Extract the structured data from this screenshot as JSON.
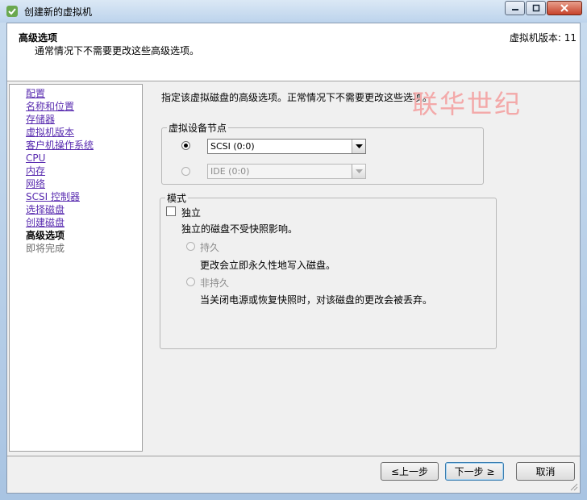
{
  "window": {
    "title": "创建新的虚拟机",
    "controls": [
      "minimize-icon",
      "maximize-icon",
      "close-icon"
    ]
  },
  "header": {
    "title": "高级选项",
    "subtitle": "通常情况下不需要更改这些高级选项。",
    "version": "虚拟机版本: 11"
  },
  "nav": {
    "items": [
      {
        "label": "配置",
        "state": "link"
      },
      {
        "label": "名称和位置",
        "state": "link"
      },
      {
        "label": "存储器",
        "state": "link"
      },
      {
        "label": "虚拟机版本",
        "state": "link"
      },
      {
        "label": "客户机操作系统",
        "state": "link"
      },
      {
        "label": "CPU",
        "state": "link"
      },
      {
        "label": "内存",
        "state": "link"
      },
      {
        "label": "网络",
        "state": "link"
      },
      {
        "label": "SCSI 控制器",
        "state": "link"
      },
      {
        "label": "选择磁盘",
        "state": "link"
      },
      {
        "label": "创建磁盘",
        "state": "link"
      },
      {
        "label": "高级选项",
        "state": "current"
      },
      {
        "label": "即将完成",
        "state": "future"
      }
    ]
  },
  "main": {
    "intro": "指定该虚拟磁盘的高级选项。正常情况下不需要更改这些选项。",
    "watermark": "联华世纪",
    "device_node": {
      "legend": "虚拟设备节点",
      "scsi_value": "SCSI (0:0)",
      "scsi_selected": true,
      "ide_value": "IDE (0:0)",
      "ide_selected": false
    },
    "mode": {
      "legend": "模式",
      "independent_label": "独立",
      "independent_checked": false,
      "independent_desc": "独立的磁盘不受快照影响。",
      "persistent_label": "持久",
      "persistent_desc": "更改会立即永久性地写入磁盘。",
      "nonpersistent_label": "非持久",
      "nonpersistent_desc": "当关闭电源或恢复快照时，对该磁盘的更改会被丢弃。"
    }
  },
  "footer": {
    "back_label": "≤上一步",
    "next_label": "下一步 ≥",
    "cancel_label": "取消"
  },
  "colors": {
    "link": "#5a2db0",
    "watermark": "#f3a9a9",
    "titlebar": "#bcd3ec"
  }
}
